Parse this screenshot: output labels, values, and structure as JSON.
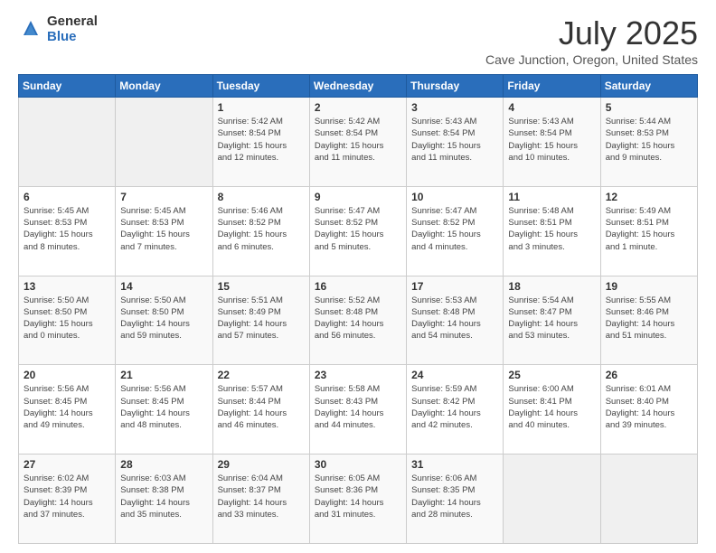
{
  "logo": {
    "general": "General",
    "blue": "Blue"
  },
  "title": "July 2025",
  "subtitle": "Cave Junction, Oregon, United States",
  "days_of_week": [
    "Sunday",
    "Monday",
    "Tuesday",
    "Wednesday",
    "Thursday",
    "Friday",
    "Saturday"
  ],
  "weeks": [
    [
      {
        "day": "",
        "info": ""
      },
      {
        "day": "",
        "info": ""
      },
      {
        "day": "1",
        "info": "Sunrise: 5:42 AM\nSunset: 8:54 PM\nDaylight: 15 hours\nand 12 minutes."
      },
      {
        "day": "2",
        "info": "Sunrise: 5:42 AM\nSunset: 8:54 PM\nDaylight: 15 hours\nand 11 minutes."
      },
      {
        "day": "3",
        "info": "Sunrise: 5:43 AM\nSunset: 8:54 PM\nDaylight: 15 hours\nand 11 minutes."
      },
      {
        "day": "4",
        "info": "Sunrise: 5:43 AM\nSunset: 8:54 PM\nDaylight: 15 hours\nand 10 minutes."
      },
      {
        "day": "5",
        "info": "Sunrise: 5:44 AM\nSunset: 8:53 PM\nDaylight: 15 hours\nand 9 minutes."
      }
    ],
    [
      {
        "day": "6",
        "info": "Sunrise: 5:45 AM\nSunset: 8:53 PM\nDaylight: 15 hours\nand 8 minutes."
      },
      {
        "day": "7",
        "info": "Sunrise: 5:45 AM\nSunset: 8:53 PM\nDaylight: 15 hours\nand 7 minutes."
      },
      {
        "day": "8",
        "info": "Sunrise: 5:46 AM\nSunset: 8:52 PM\nDaylight: 15 hours\nand 6 minutes."
      },
      {
        "day": "9",
        "info": "Sunrise: 5:47 AM\nSunset: 8:52 PM\nDaylight: 15 hours\nand 5 minutes."
      },
      {
        "day": "10",
        "info": "Sunrise: 5:47 AM\nSunset: 8:52 PM\nDaylight: 15 hours\nand 4 minutes."
      },
      {
        "day": "11",
        "info": "Sunrise: 5:48 AM\nSunset: 8:51 PM\nDaylight: 15 hours\nand 3 minutes."
      },
      {
        "day": "12",
        "info": "Sunrise: 5:49 AM\nSunset: 8:51 PM\nDaylight: 15 hours\nand 1 minute."
      }
    ],
    [
      {
        "day": "13",
        "info": "Sunrise: 5:50 AM\nSunset: 8:50 PM\nDaylight: 15 hours\nand 0 minutes."
      },
      {
        "day": "14",
        "info": "Sunrise: 5:50 AM\nSunset: 8:50 PM\nDaylight: 14 hours\nand 59 minutes."
      },
      {
        "day": "15",
        "info": "Sunrise: 5:51 AM\nSunset: 8:49 PM\nDaylight: 14 hours\nand 57 minutes."
      },
      {
        "day": "16",
        "info": "Sunrise: 5:52 AM\nSunset: 8:48 PM\nDaylight: 14 hours\nand 56 minutes."
      },
      {
        "day": "17",
        "info": "Sunrise: 5:53 AM\nSunset: 8:48 PM\nDaylight: 14 hours\nand 54 minutes."
      },
      {
        "day": "18",
        "info": "Sunrise: 5:54 AM\nSunset: 8:47 PM\nDaylight: 14 hours\nand 53 minutes."
      },
      {
        "day": "19",
        "info": "Sunrise: 5:55 AM\nSunset: 8:46 PM\nDaylight: 14 hours\nand 51 minutes."
      }
    ],
    [
      {
        "day": "20",
        "info": "Sunrise: 5:56 AM\nSunset: 8:45 PM\nDaylight: 14 hours\nand 49 minutes."
      },
      {
        "day": "21",
        "info": "Sunrise: 5:56 AM\nSunset: 8:45 PM\nDaylight: 14 hours\nand 48 minutes."
      },
      {
        "day": "22",
        "info": "Sunrise: 5:57 AM\nSunset: 8:44 PM\nDaylight: 14 hours\nand 46 minutes."
      },
      {
        "day": "23",
        "info": "Sunrise: 5:58 AM\nSunset: 8:43 PM\nDaylight: 14 hours\nand 44 minutes."
      },
      {
        "day": "24",
        "info": "Sunrise: 5:59 AM\nSunset: 8:42 PM\nDaylight: 14 hours\nand 42 minutes."
      },
      {
        "day": "25",
        "info": "Sunrise: 6:00 AM\nSunset: 8:41 PM\nDaylight: 14 hours\nand 40 minutes."
      },
      {
        "day": "26",
        "info": "Sunrise: 6:01 AM\nSunset: 8:40 PM\nDaylight: 14 hours\nand 39 minutes."
      }
    ],
    [
      {
        "day": "27",
        "info": "Sunrise: 6:02 AM\nSunset: 8:39 PM\nDaylight: 14 hours\nand 37 minutes."
      },
      {
        "day": "28",
        "info": "Sunrise: 6:03 AM\nSunset: 8:38 PM\nDaylight: 14 hours\nand 35 minutes."
      },
      {
        "day": "29",
        "info": "Sunrise: 6:04 AM\nSunset: 8:37 PM\nDaylight: 14 hours\nand 33 minutes."
      },
      {
        "day": "30",
        "info": "Sunrise: 6:05 AM\nSunset: 8:36 PM\nDaylight: 14 hours\nand 31 minutes."
      },
      {
        "day": "31",
        "info": "Sunrise: 6:06 AM\nSunset: 8:35 PM\nDaylight: 14 hours\nand 28 minutes."
      },
      {
        "day": "",
        "info": ""
      },
      {
        "day": "",
        "info": ""
      }
    ]
  ]
}
